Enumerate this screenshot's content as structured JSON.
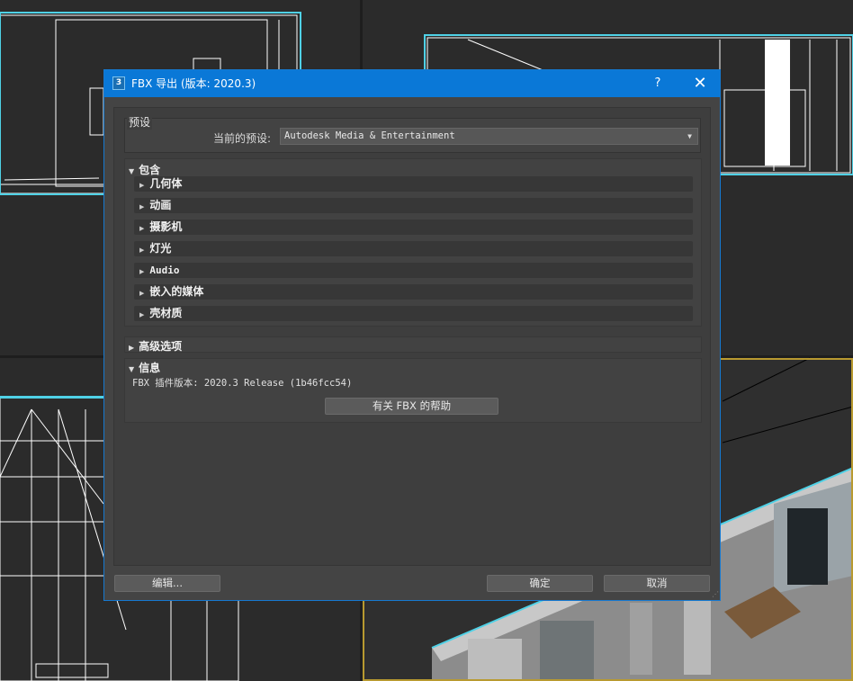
{
  "dialog": {
    "title": "FBX 导出 (版本: 2020.3)",
    "app_icon_text": "3",
    "help_glyph": "?",
    "close_glyph": "✕"
  },
  "presets": {
    "legend": "预设",
    "current_label": "当前的预设:",
    "current_value": "Autodesk Media & Entertainment",
    "dropdown_arrow": "▼"
  },
  "include": {
    "header": "包含",
    "expanded": true,
    "items": [
      {
        "label": "几何体"
      },
      {
        "label": "动画"
      },
      {
        "label": "摄影机"
      },
      {
        "label": "灯光"
      },
      {
        "label": "Audio"
      },
      {
        "label": "嵌入的媒体"
      },
      {
        "label": "壳材质"
      }
    ]
  },
  "advanced": {
    "header": "高级选项",
    "expanded": false
  },
  "information": {
    "header": "信息",
    "expanded": true,
    "plugin_version": "FBX 插件版本: 2020.3 Release (1b46fcc54)",
    "help_button": "有关 FBX 的帮助"
  },
  "footer": {
    "edit_button": "编辑...",
    "ok_button": "确定",
    "cancel_button": "取消"
  },
  "colors": {
    "titlebar": "#0a78d7",
    "dialog_bg": "#444444",
    "wireframe": "#ffffff",
    "selection": "#4fd1e6"
  }
}
